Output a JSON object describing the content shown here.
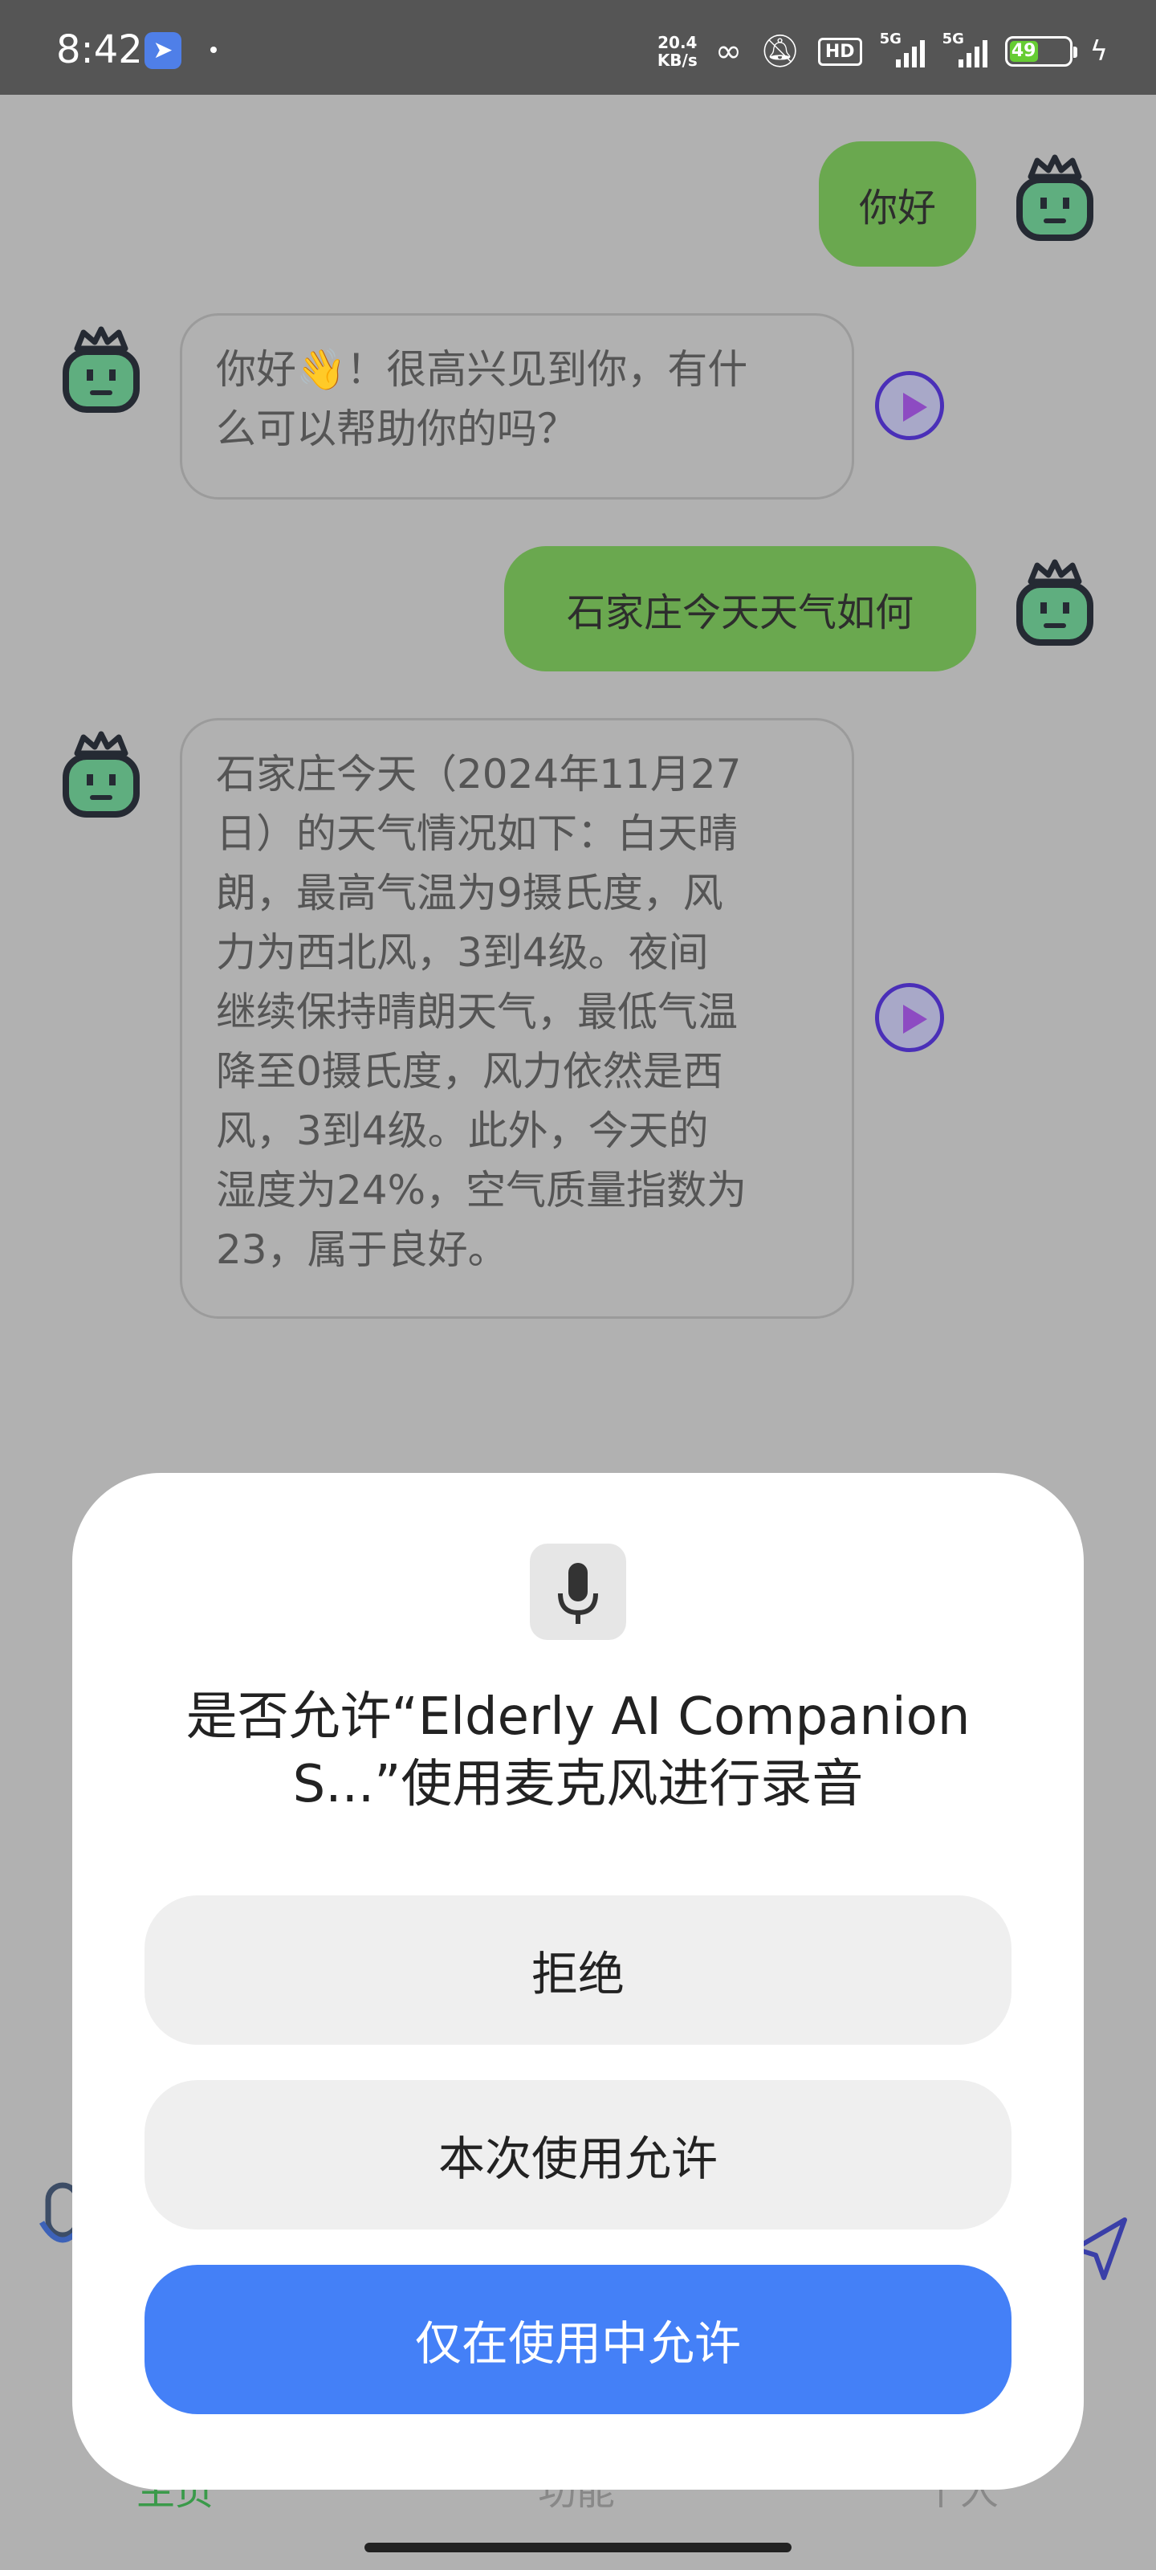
{
  "status_bar": {
    "time": "8:42",
    "net_speed_value": "20.4",
    "net_speed_unit": "KB/s",
    "hd_label": "HD",
    "network_1": "5G",
    "network_2": "5G",
    "battery_percent": "49",
    "battery_color": "#66cc33",
    "icons": [
      "app-notification-icon",
      "link-icon",
      "mute-bell-icon",
      "signal-icon",
      "battery-icon",
      "charging-icon"
    ]
  },
  "chat": {
    "messages": [
      {
        "role": "user",
        "text": "你好"
      },
      {
        "role": "assistant",
        "line1": "你好👋！很高兴见到你，有什",
        "line2": "么可以帮助你的吗？"
      },
      {
        "role": "user",
        "text": "石家庄今天天气如何"
      },
      {
        "role": "assistant",
        "lines": [
          "石家庄今天（2024年11月27",
          "日）的天气情况如下：白天晴",
          "朗，最高气温为9摄氏度，风",
          "力为西北风，3到4级。夜间",
          "继续保持晴朗天气，最低气温",
          "降至0摄氏度，风力依然是西",
          "风，3到4级。此外，今天的",
          "湿度为24%，空气质量指数为",
          "23，属于良好。"
        ]
      }
    ],
    "colors": {
      "user_bubble": "#6aa84f",
      "play_button": "#4a2fb8"
    }
  },
  "dialog": {
    "title_line1": "是否允许“Elderly AI Companion",
    "title_line2": "S...”使用麦克风进行录音",
    "deny_label": "拒绝",
    "allow_once_label": "本次使用允许",
    "allow_while_using_label": "仅在使用中允许",
    "primary_color": "#4480f7"
  },
  "bottom_nav_partial": {
    "tab1": "主页",
    "tab2": "功能",
    "tab3": "个人"
  }
}
